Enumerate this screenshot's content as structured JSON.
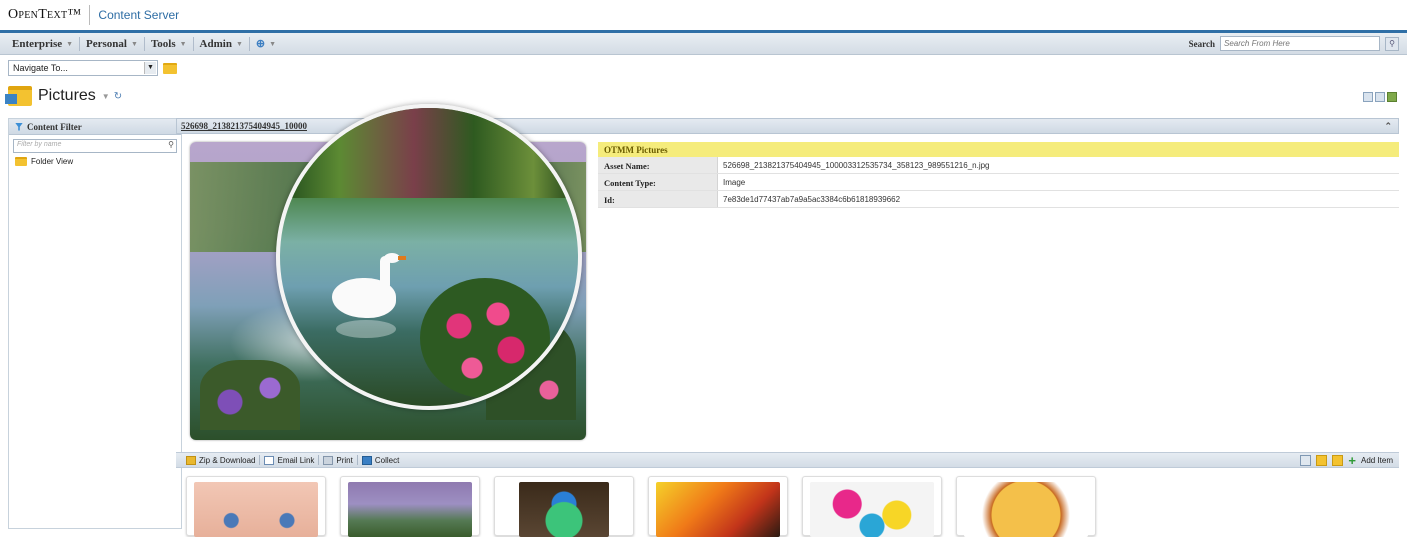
{
  "brand": {
    "logo": "OpenText™",
    "product": "Content Server"
  },
  "menu": {
    "items": [
      "Enterprise",
      "Personal",
      "Tools",
      "Admin"
    ],
    "search_label": "Search",
    "search_placeholder": "Search From Here"
  },
  "navigate": {
    "selected": "Navigate To..."
  },
  "page": {
    "title": "Pictures"
  },
  "sidebar": {
    "header": "Content Filter",
    "filter_placeholder": "Filter by name",
    "folder_view": "Folder View"
  },
  "content": {
    "header": "526698_213821375404945_10000"
  },
  "metadata": {
    "title": "OTMM Pictures",
    "rows": [
      {
        "key": "Asset Name:",
        "value": "526698_213821375404945_100003312535734_358123_989551216_n.jpg"
      },
      {
        "key": "Content Type:",
        "value": "Image"
      },
      {
        "key": "Id:",
        "value": "7e83de1d77437ab7a9a5ac3384c6b61818939662"
      }
    ]
  },
  "toolbar": {
    "zip": "Zip & Download",
    "email": "Email Link",
    "print": "Print",
    "collect": "Collect",
    "add_item": "Add Item"
  },
  "colors": {
    "accent": "#2f6fa6",
    "metadata_header": "#f5ec7c"
  }
}
